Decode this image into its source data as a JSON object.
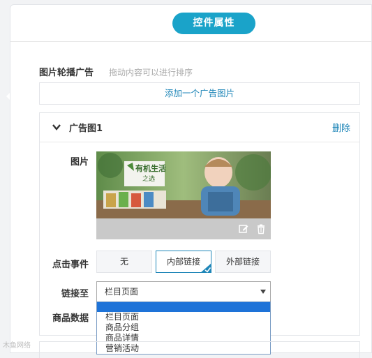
{
  "header": {
    "title": "控件属性"
  },
  "carousel": {
    "label": "图片轮播广告",
    "hint": "拖动内容可以进行排序",
    "add_label": "添加一个广告图片"
  },
  "ad_card": {
    "title": "广告图1",
    "delete_label": "删除",
    "image_label": "图片",
    "image_caption_line1": "有机生活",
    "image_caption_line2": "之选",
    "click_event_label": "点击事件",
    "options": [
      "无",
      "内部链接",
      "外部链接"
    ],
    "selected_option": "内部链接",
    "link_label": "链接至",
    "link_value": "栏目页面",
    "product_data_label": "商品数据",
    "dropdown_items": [
      "",
      "栏目页面",
      "商品分组",
      "商品详情",
      "营销活动"
    ]
  },
  "colors": {
    "accent": "#1aa3c9",
    "link": "#1f86b8",
    "highlight": "#1e73d8"
  },
  "watermark": "木鱼网络"
}
